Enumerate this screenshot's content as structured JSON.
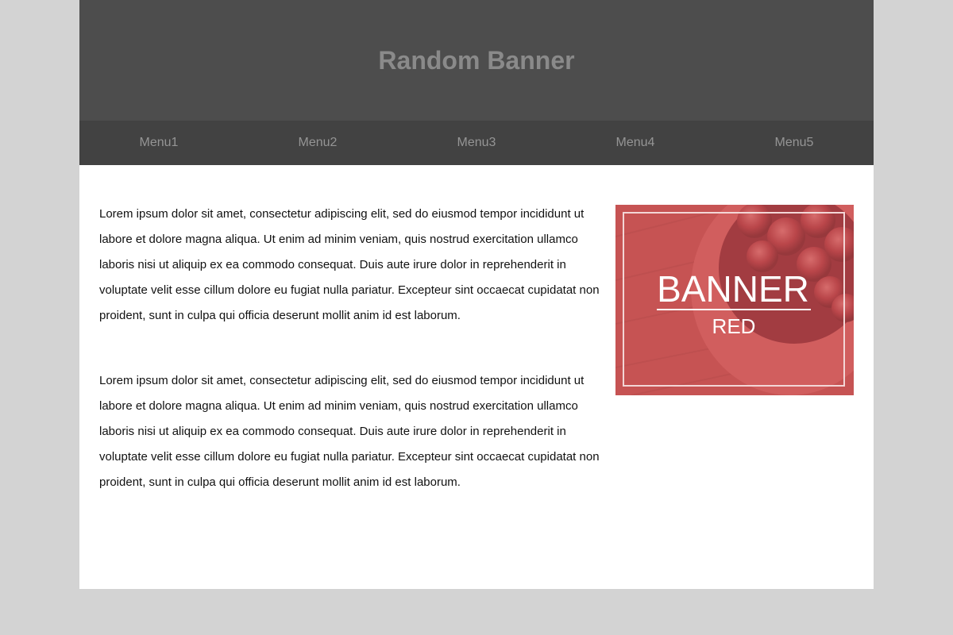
{
  "header": {
    "title": "Random Banner"
  },
  "nav": {
    "items": [
      {
        "label": "Menu1"
      },
      {
        "label": "Menu2"
      },
      {
        "label": "Menu3"
      },
      {
        "label": "Menu4"
      },
      {
        "label": "Menu5"
      }
    ]
  },
  "main": {
    "paragraphs": [
      "Lorem ipsum dolor sit amet, consectetur adipiscing elit, sed do eiusmod tempor incididunt ut labore et dolore magna aliqua. Ut enim ad minim veniam, quis nostrud exercitation ullamco laboris nisi ut aliquip ex ea commodo consequat. Duis aute irure dolor in reprehenderit in voluptate velit esse cillum dolore eu fugiat nulla pariatur. Excepteur sint occaecat cupidatat non proident, sunt in culpa qui officia deserunt mollit anim id est laborum.",
      "Lorem ipsum dolor sit amet, consectetur adipiscing elit, sed do eiusmod tempor incididunt ut labore et dolore magna aliqua. Ut enim ad minim veniam, quis nostrud exercitation ullamco laboris nisi ut aliquip ex ea commodo consequat. Duis aute irure dolor in reprehenderit in voluptate velit esse cillum dolore eu fugiat nulla pariatur. Excepteur sint occaecat cupidatat non proident, sunt in culpa qui officia deserunt mollit anim id est laborum."
    ]
  },
  "banner": {
    "headline": "BANNER",
    "subline": "RED",
    "tint_color": "#c65454"
  },
  "colors": {
    "background": "#d3d3d3",
    "header": "#4d4d4d",
    "nav": "#424242",
    "title_text": "#8a8a8a",
    "nav_text": "#959595"
  }
}
